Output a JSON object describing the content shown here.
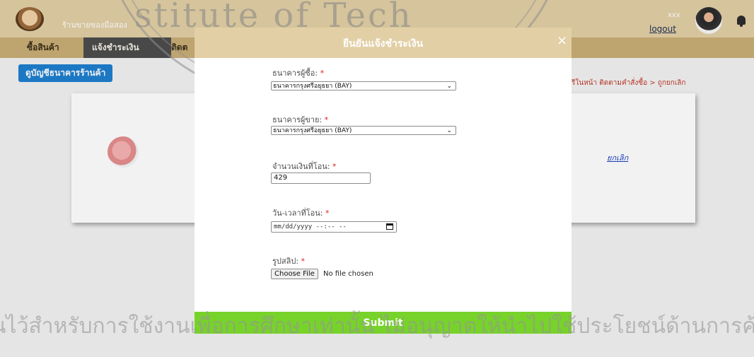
{
  "header": {
    "shop_name": "ร้านขายของมือสอง",
    "user_name": "xxx",
    "logout_label": "logout"
  },
  "nav": {
    "items": [
      {
        "label": "ซื้อสินค้า"
      },
      {
        "label": "แจ้งชำระเงิน"
      },
      {
        "label": "ติดต"
      }
    ]
  },
  "page": {
    "bank_button_label": "ดูบัญชีธนาคารร้านค้า",
    "breadcrumb": "รีในหน้า ติดตามคำสั่งซื้อ > ถูกยกเลิก",
    "cancel_link": "ยกเลิก"
  },
  "watermark": {
    "top_text": "stitute of Tech",
    "bottom_text": "นไว้สำหรับการใช้งานเพื่อการศึกษาเท่านั้น ไม่อนุญาตให้นำไปใช้ประโยชน์ด้านการค้า"
  },
  "modal": {
    "title": "ยืนยันแจ้งชำระเงิน",
    "close_glyph": "×",
    "required_mark": "*",
    "buyer_bank": {
      "label": "ธนาคารผู้ซื้อ:",
      "value": "ธนาคารกรุงศรีอยุธยา (BAY)"
    },
    "seller_bank": {
      "label": "ธนาคารผู้ขาย:",
      "value": "ธนาคารกรุงศรีอยุธยา (BAY)"
    },
    "amount": {
      "label": "จำนวนเงินที่โอน:",
      "value": "429"
    },
    "datetime": {
      "label": "วัน-เวลาที่โอน:",
      "value": "mm/dd/yyyy --:-- --"
    },
    "slip": {
      "label": "รูปสลิป:",
      "button_label": "Choose File",
      "status": "No file chosen"
    },
    "submit_label": "Submit"
  }
}
